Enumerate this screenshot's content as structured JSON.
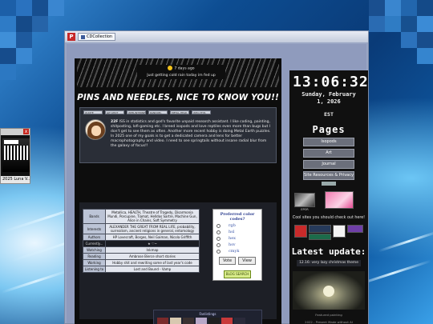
{
  "window": {
    "app_icon": "P",
    "tab_label": "CDCollection"
  },
  "mini_window": {
    "close": "x",
    "caption": "2025 Luna V..."
  },
  "status": {
    "time_ago": "7 days ago",
    "message": "Just getting cold rain today im fed up"
  },
  "banner": {
    "title": "PINS AND NEEDLES, NICE TO KNOW YOU!!"
  },
  "profile": {
    "buttons": [
      "QUOTE",
      "GIF-SHOT",
      "WEB-INTERNET",
      "RANDOM-",
      "METAL-HEAD",
      "WHO-THIS"
    ],
    "bio_lead": "22F",
    "bio": "ISS in statistics and god's favorite unpaid research assistant. I like coding, painting, shitposting, lofi-gaming etc. I breed isopods and love reptiles even more than bugs but I don't get to see them as often. Another more recent hobby is doing Metal Earth puzzles. In 2025 one of my goals is to get a dedicated camera and lens for better macrophotography and video. I need to see springtails without insane radial blur from the galaxy of focus!!"
  },
  "info_table": [
    {
      "key": "Bands",
      "value": "Metallica, HEALTH, Theatre of Tragedy, Disarmonia Mundi, Porcupine, Tiamat, Helldos Sartre, Machine Gun, Alice in Chains, Soft Symmetry",
      "dark": false
    },
    {
      "key": "Interests",
      "value": "ALEXANDER THE GREAT FROM REAL LIFE, probability, surrealism, ancient religions in general, entomology",
      "dark": false
    },
    {
      "key": "Authors",
      "value": "HP Lovecraft, Borges, Neil Gaiman, Nicola Griffith",
      "dark": false
    },
    {
      "key": "Currently...",
      "value": "★ ♡~",
      "dark": true
    },
    {
      "key": "Watching",
      "value": "Inkmap",
      "dark": false
    },
    {
      "key": "Reading",
      "value": "Ambrose Bierce short stories",
      "dark": false
    },
    {
      "key": "Working",
      "value": "Hobby shit and rewriting some of last year's code",
      "dark": false
    },
    {
      "key": "Listening to",
      "value": "Lost and Bound - Vamp",
      "dark": false
    }
  ],
  "poll": {
    "title": "Preferred color codes?",
    "options": [
      "rgb",
      "hsl",
      "hex",
      "hsv",
      "cmyk"
    ],
    "vote": "Vote",
    "view": "View",
    "stamp": "BLOG SEARCH"
  },
  "fanlistings": {
    "label": "Fanlistings"
  },
  "sidebar": {
    "clock": "13:06:32",
    "date_line1": "Sunday, February",
    "date_line2": "1, 2026",
    "timezone": "EST",
    "pages_title": "Pages",
    "nav": [
      "Isopods",
      "Art",
      "Journal",
      "Site Resources & Privacy"
    ],
    "webring": "webring",
    "buttons": [
      "EPOR",
      ""
    ],
    "cool_text": "Cool sites you should check out here!",
    "latest_title": "Latest update:",
    "latest_text": "12.16: very lazy christmas theme",
    "painting_caption": "Featured painting",
    "footer": "2022 - Present  Made without AI"
  },
  "colors": {
    "page_bg": "#0d0d0d",
    "card_bg": "#2a2e37",
    "nav_btn": "#6b6f7b"
  }
}
